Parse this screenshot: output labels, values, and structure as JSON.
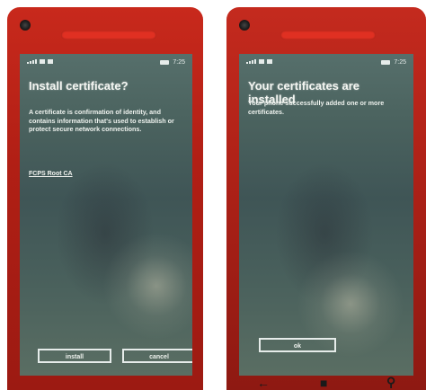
{
  "left_phone": {
    "status": {
      "time": "7:25"
    },
    "title": "Install certificate?",
    "body": "A certificate is confirmation of identity, and contains information that's used to establish or protect secure network connections.",
    "certificate_name": "FCPS Root CA",
    "buttons": {
      "install": "install",
      "cancel": "cancel"
    }
  },
  "right_phone": {
    "status": {
      "time": "7:25"
    },
    "title": "Your certificates are installed",
    "body": "Your phone successfully added one or more certificates.",
    "buttons": {
      "ok": "ok"
    }
  },
  "colors": {
    "phone_body": "#b11f15",
    "speaker": "#e03022",
    "screen": "#4b635f",
    "text": "#f4f6f2"
  }
}
